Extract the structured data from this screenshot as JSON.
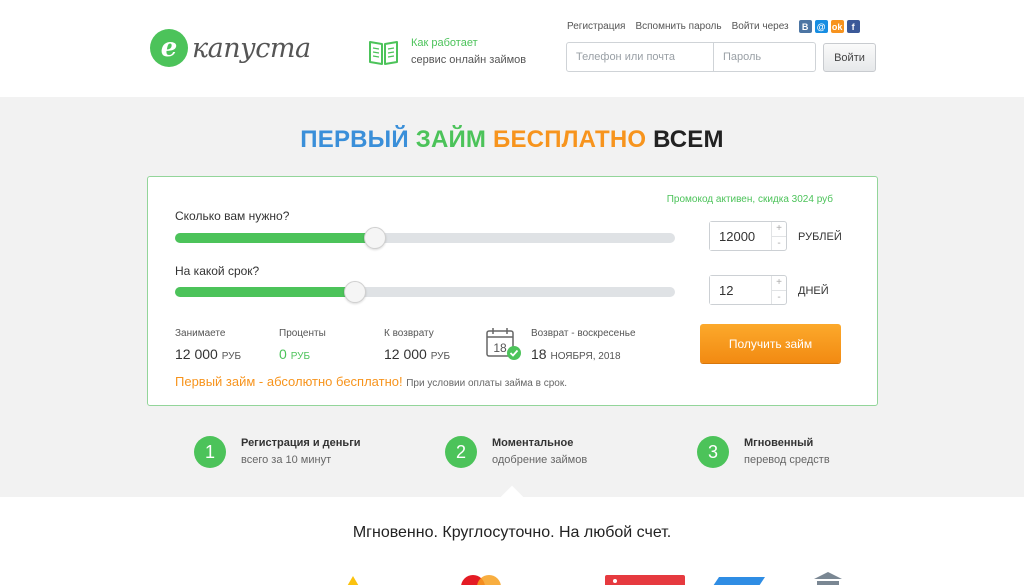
{
  "header": {
    "logo": {
      "badge": "е",
      "text": "капуста"
    },
    "how": {
      "line1": "Как работает",
      "line2": "сервис онлайн займов"
    },
    "links": {
      "register": "Регистрация",
      "remember": "Вспомнить пароль",
      "login_via": "Войти через"
    },
    "social": {
      "vk": "B",
      "mailru": "@",
      "ok": "ok",
      "fb": "f"
    },
    "login": {
      "phone_placeholder": "Телефон или почта",
      "password_placeholder": "Пароль",
      "button": "Войти"
    }
  },
  "headline": {
    "part1": "ПЕРВЫЙ",
    "part2": "ЗАЙМ",
    "part3": "БЕСПЛАТНО",
    "part4": "ВСЕМ"
  },
  "calculator": {
    "promo": "Промокод активен, скидка 3024 руб",
    "amount": {
      "question": "Сколько вам нужно?",
      "value": "12000",
      "unit": "РУБЛЕЙ",
      "slider_fraction": 0.4
    },
    "term": {
      "question": "На какой срок?",
      "value": "12",
      "unit": "ДНЕЙ",
      "slider_fraction": 0.36
    },
    "spin": {
      "plus": "+",
      "minus": "-"
    },
    "stats": {
      "borrow": {
        "label": "Занимаете",
        "value": "12 000",
        "currency": "РУБ"
      },
      "interest": {
        "label": "Проценты",
        "value": "0",
        "currency": "РУБ"
      },
      "to_return": {
        "label": "К возврату",
        "value": "12 000",
        "currency": "РУБ"
      },
      "return_date": {
        "label": "Возврат - воскресенье",
        "day": "18",
        "month_year": "НОЯБРЯ, 2018",
        "calendar_day": "18"
      }
    },
    "button": "Получить займ",
    "free_note": "Первый займ - абсолютно бесплатно!",
    "free_condition": "При условии оплаты займа в срок."
  },
  "steps": [
    {
      "num": "1",
      "title": "Регистрация и деньги",
      "sub": "всего за 10 минут"
    },
    {
      "num": "2",
      "title": "Моментальное",
      "sub": "одобрение займов"
    },
    {
      "num": "3",
      "title": "Мгновенный",
      "sub": "перевод средств"
    }
  ],
  "tagline": "Мгновенно. Круглосуточно. На любой счет.",
  "colors": {
    "green": "#4cc35a",
    "orange": "#f7941d",
    "blue": "#3a8fd9"
  }
}
